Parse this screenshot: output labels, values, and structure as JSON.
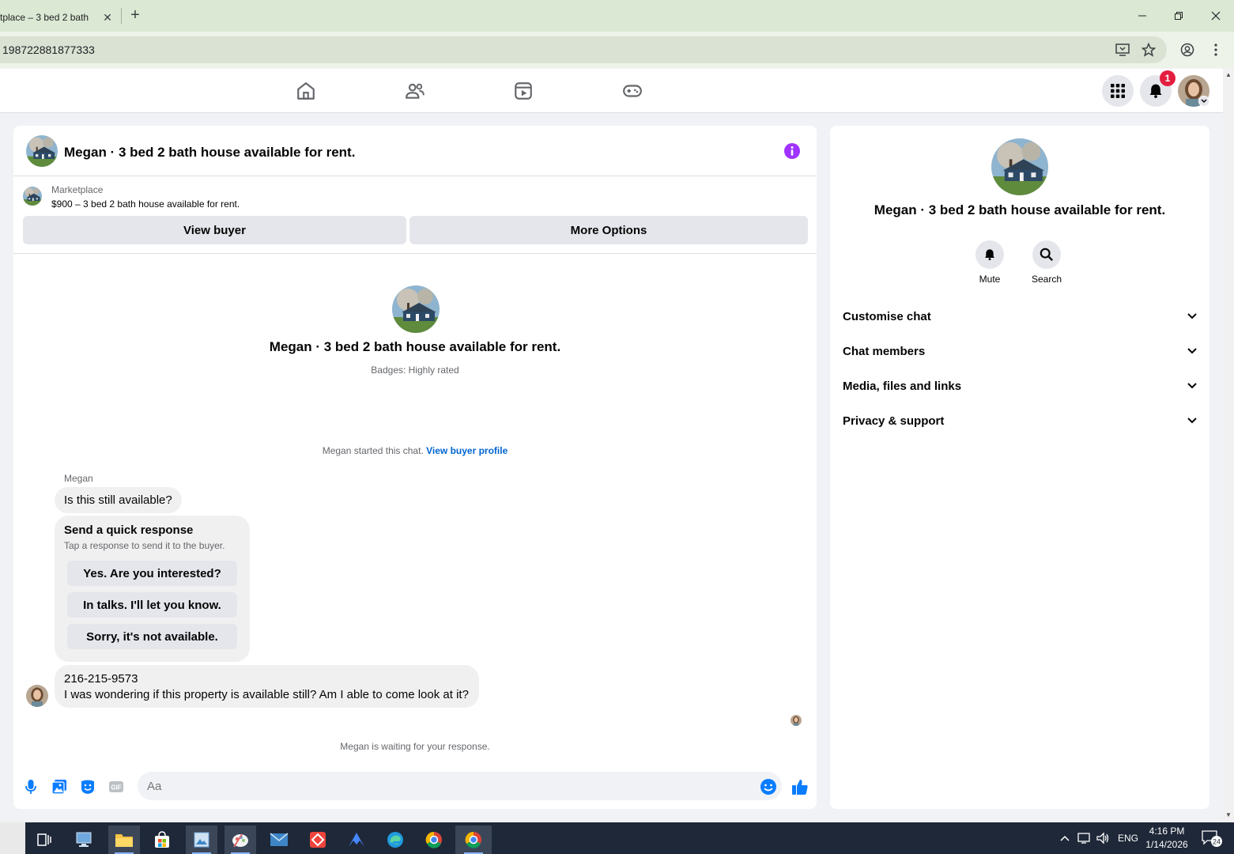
{
  "browser": {
    "tab_title": "tplace – 3 bed 2 bath",
    "tab_close": "✕",
    "new_tab": "+",
    "url": "198722881877333"
  },
  "fb": {
    "notification_count": "1"
  },
  "chat": {
    "header_title": "Megan · 3 bed 2 bath house available for rent.",
    "listing_source": "Marketplace",
    "listing_title": "$900 – 3 bed 2 bath house available for rent.",
    "view_buyer": "View buyer",
    "more_options": "More Options",
    "thread_name": "Megan · 3 bed 2 bath house available for rent.",
    "badges": "Badges: Highly rated",
    "started_text": "Megan started this chat.",
    "view_buyer_profile": "View buyer profile",
    "sender_name": "Megan",
    "message1": "Is this still available?",
    "quick_response_title": "Send a quick response",
    "quick_response_sub": "Tap a response to send it to the buyer.",
    "quick_responses": [
      "Yes. Are you interested?",
      "In talks. I'll let you know.",
      "Sorry, it's not available."
    ],
    "message2_line1": "216-215-9573",
    "message2_line2": "I was wondering if this property is available still? Am I able to come look at it?",
    "waiting": "Megan is waiting for your response.",
    "input_placeholder": "Aa"
  },
  "panel": {
    "name": "Megan · 3 bed 2 bath house available for rent.",
    "mute": "Mute",
    "search": "Search",
    "sections": [
      "Customise chat",
      "Chat members",
      "Media, files and links",
      "Privacy & support"
    ]
  },
  "taskbar": {
    "lang": "ENG",
    "time": "4:16 PM",
    "date": "1/14/2026",
    "notifications": "24"
  },
  "colors": {
    "accent_blue": "#0064d1",
    "info_purple": "#a033ff",
    "like_blue": "#0a7cff"
  }
}
